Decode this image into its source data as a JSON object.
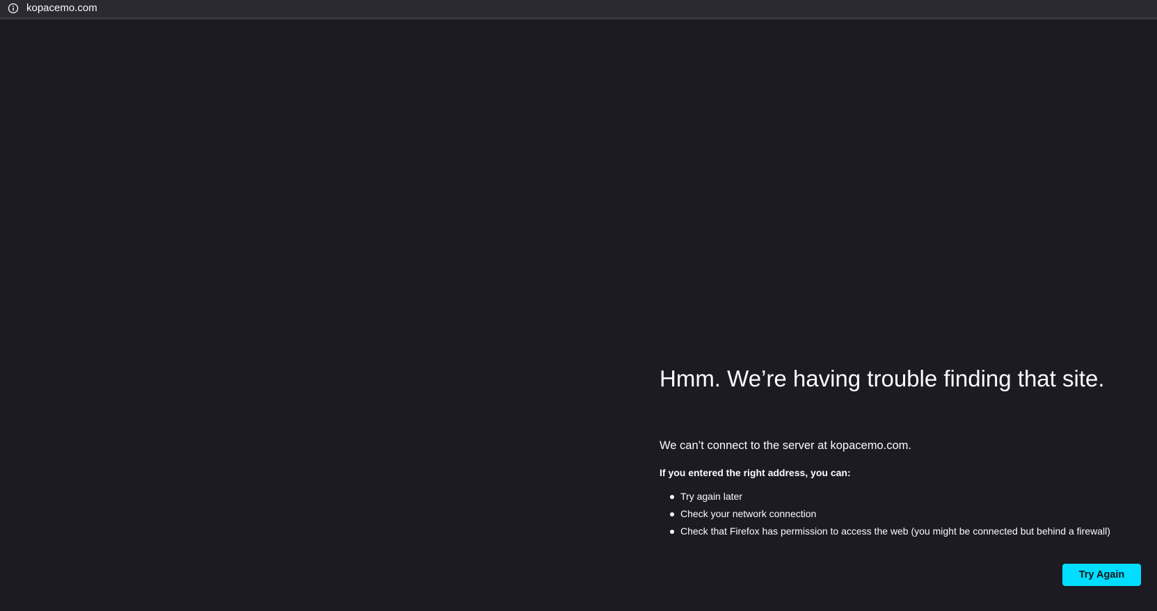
{
  "browser": {
    "url": "kopacemo.com",
    "info_icon": "info-icon"
  },
  "error": {
    "title": "Hmm. We’re having trouble finding that site.",
    "description": "We can’t connect to the server at kopacemo.com.",
    "suggestions_heading": "If you entered the right address, you can:",
    "suggestions": [
      "Try again later",
      "Check your network connection",
      "Check that Firefox has permission to access the web (you might be connected but behind a firewall)"
    ],
    "try_again_label": "Try Again"
  },
  "colors": {
    "background": "#1c1b22",
    "urlbar": "#2b2a33",
    "text": "#fbfbfe",
    "button": "#00ddff",
    "button_text": "#15141a"
  }
}
